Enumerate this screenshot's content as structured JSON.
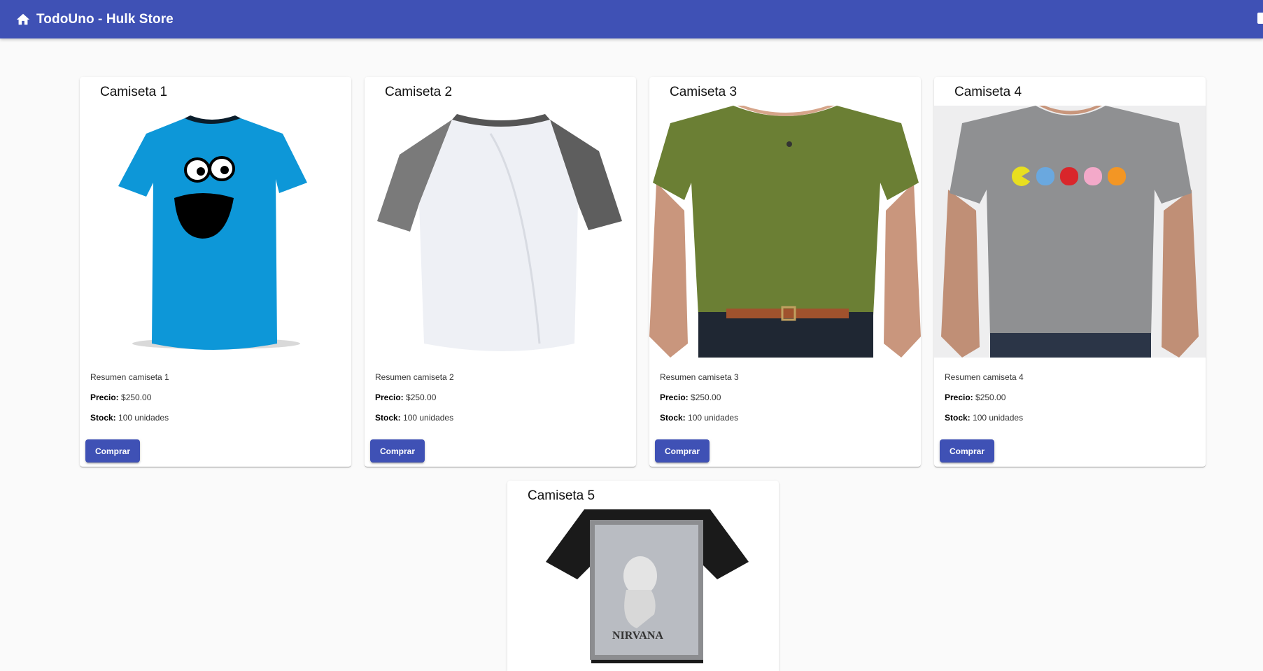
{
  "toolbar": {
    "title": "TodoUno - Hulk Store",
    "home_icon": "home-icon"
  },
  "products": [
    {
      "title": "Camiseta 1",
      "image": "blue-tshirt-cookie-monster",
      "summary": "Resumen camiseta 1",
      "price_label": "Precio:",
      "price": "$250.00",
      "stock_label": "Stock:",
      "stock": "100 unidades",
      "button": "Comprar"
    },
    {
      "title": "Camiseta 2",
      "image": "white-grey-raglan-tshirt",
      "summary": "Resumen camiseta 2",
      "price_label": "Precio:",
      "price": "$250.00",
      "stock_label": "Stock:",
      "stock": "100 unidades",
      "button": "Comprar"
    },
    {
      "title": "Camiseta 3",
      "image": "green-henley-tshirt-model",
      "summary": "Resumen camiseta 3",
      "price_label": "Precio:",
      "price": "$250.00",
      "stock_label": "Stock:",
      "stock": "100 unidades",
      "button": "Comprar"
    },
    {
      "title": "Camiseta 4",
      "image": "grey-pacman-tshirt-model",
      "summary": "Resumen camiseta 4",
      "price_label": "Precio:",
      "price": "$250.00",
      "stock_label": "Stock:",
      "stock": "100 unidades",
      "button": "Comprar"
    },
    {
      "title": "Camiseta 5",
      "image": "black-nirvana-tshirt",
      "summary": "",
      "price_label": "",
      "price": "",
      "stock_label": "",
      "stock": "",
      "button": ""
    }
  ],
  "colors": {
    "primary": "#3f51b5",
    "background": "#fafafa",
    "card": "#ffffff"
  }
}
